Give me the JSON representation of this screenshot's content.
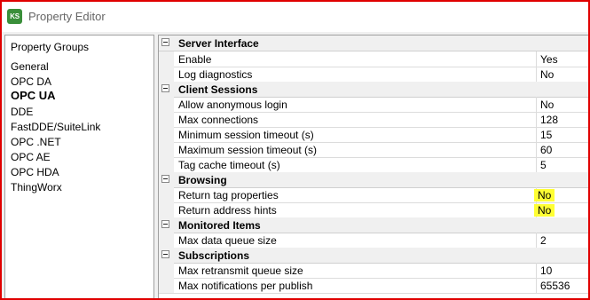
{
  "window": {
    "title": "Property Editor",
    "icon": "KS"
  },
  "groups": {
    "header": "Property Groups",
    "items": [
      "General",
      "OPC DA",
      "OPC UA",
      "DDE",
      "FastDDE/SuiteLink",
      "OPC .NET",
      "OPC AE",
      "OPC HDA",
      "ThingWorx"
    ],
    "selected": "OPC UA"
  },
  "grid": {
    "categories": [
      {
        "name": "Server Interface",
        "props": [
          {
            "name": "Enable",
            "value": "Yes"
          },
          {
            "name": "Log diagnostics",
            "value": "No"
          }
        ]
      },
      {
        "name": "Client Sessions",
        "props": [
          {
            "name": "Allow anonymous login",
            "value": "No"
          },
          {
            "name": "Max connections",
            "value": "128"
          },
          {
            "name": "Minimum session timeout (s)",
            "value": "15"
          },
          {
            "name": "Maximum session timeout (s)",
            "value": "60"
          },
          {
            "name": "Tag cache timeout (s)",
            "value": "5"
          }
        ]
      },
      {
        "name": "Browsing",
        "props": [
          {
            "name": "Return tag properties",
            "value": "No",
            "highlighted": true
          },
          {
            "name": "Return address hints",
            "value": "No",
            "highlighted": true
          }
        ]
      },
      {
        "name": "Monitored Items",
        "props": [
          {
            "name": "Max data queue size",
            "value": "2"
          }
        ]
      },
      {
        "name": "Subscriptions",
        "props": [
          {
            "name": "Max retransmit queue size",
            "value": "10"
          },
          {
            "name": "Max notifications per publish",
            "value": "65536"
          }
        ]
      }
    ]
  },
  "colors": {
    "highlight": "#ffff33",
    "border_accent": "#e00000",
    "icon_green": "#3a8f3a"
  }
}
